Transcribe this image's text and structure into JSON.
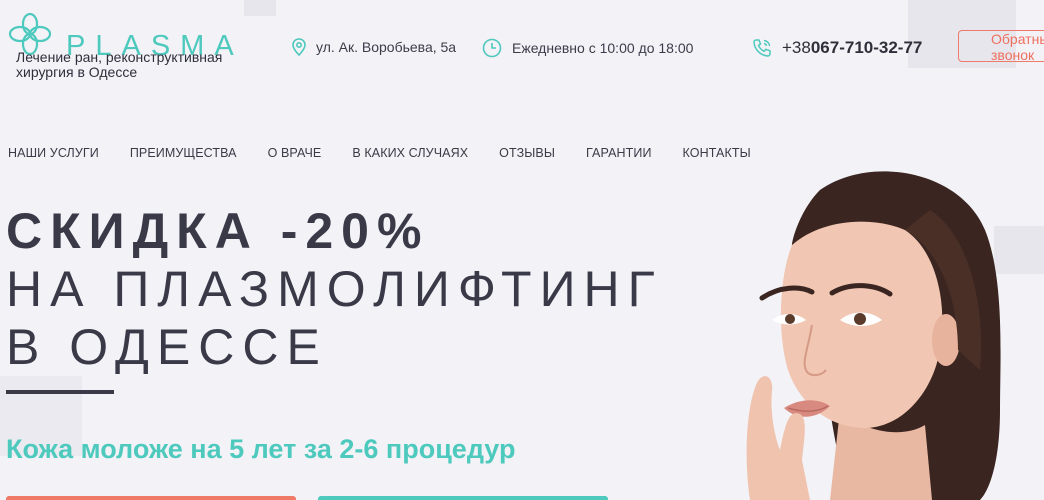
{
  "brand": {
    "name": "PLASMA",
    "tagline": "Лечение ран, реконструктивная хирургия в Одессе"
  },
  "header": {
    "address": "ул. Ак. Воробьева, 5а",
    "hours": "Ежедневно с 10:00 до 18:00",
    "phone_prefix": "+38 ",
    "phone_number": "067-710-32-77",
    "callback_label": "Обратный звонок"
  },
  "nav": {
    "items": [
      "НАШИ УСЛУГИ",
      "ПРЕИМУЩЕСТВА",
      "О ВРАЧЕ",
      "В КАКИХ СЛУЧАЯХ",
      "ОТЗЫВЫ",
      "ГАРАНТИИ",
      "КОНТАКТЫ"
    ]
  },
  "hero": {
    "line1": "СКИДКА -20%",
    "line2": "НА ПЛАЗМОЛИФТИНГ",
    "line3": "В ОДЕССЕ",
    "subtitle": "Кожа моложе на 5 лет за 2-6 процедур"
  },
  "icons": {
    "logo": "four-petal-flower-icon",
    "address": "map-pin-icon",
    "hours": "clock-icon",
    "phone": "phone-ring-icon"
  },
  "colors": {
    "accent": "#4ec9bd",
    "coral": "#ef7a66",
    "text_dark": "#3a3948",
    "background": "#f3f2f7"
  }
}
